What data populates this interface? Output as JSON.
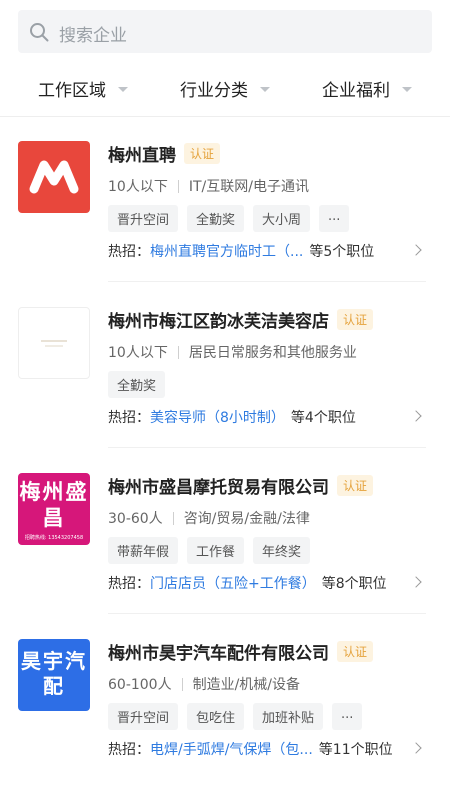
{
  "search": {
    "placeholder": "搜索企业"
  },
  "filters": [
    {
      "label": "工作区域"
    },
    {
      "label": "行业分类"
    },
    {
      "label": "企业福利"
    }
  ],
  "colors": {
    "link": "#2f7be0",
    "badge_bg": "#fdf3e0",
    "badge_text": "#e5a23b"
  },
  "companies": [
    {
      "name": "梅州直聘",
      "badge": "认证",
      "size": "10人以下",
      "industry": "IT/互联网/电子通讯",
      "tags": [
        "晋升空间",
        "全勤奖",
        "大小周",
        "..."
      ],
      "hot_prefix": "热招：",
      "hot_job": "梅州直聘官方临时工（...",
      "hot_count": "等5个职位",
      "logo_icon": "mz-logo"
    },
    {
      "name": "梅州市梅江区韵冰芙洁美容店",
      "badge": "认证",
      "size": "10人以下",
      "industry": "居民日常服务和其他服务业",
      "tags": [
        "全勤奖"
      ],
      "hot_prefix": "热招：",
      "hot_job": "美容导师（8小时制）",
      "hot_count": "等4个职位",
      "logo_icon": "beauty-logo"
    },
    {
      "name": "梅州市盛昌摩托贸易有限公司",
      "badge": "认证",
      "size": "30-60人",
      "industry": "咨询/贸易/金融/法律",
      "tags": [
        "带薪年假",
        "工作餐",
        "年终奖"
      ],
      "hot_prefix": "热招：",
      "hot_job": "门店店员（五险+工作餐）",
      "hot_count": "等8个职位",
      "logo_icon": "shengchang-logo",
      "logo_text": "梅州盛昌",
      "logo_small": "招聘热线: 13543207458"
    },
    {
      "name": "梅州市昊宇汽车配件有限公司",
      "badge": "认证",
      "size": "60-100人",
      "industry": "制造业/机械/设备",
      "tags": [
        "晋升空间",
        "包吃住",
        "加班补贴",
        "..."
      ],
      "hot_prefix": "热招：",
      "hot_job": "电焊/手弧焊/气保焊（包...",
      "hot_count": "等11个职位",
      "logo_icon": "haoyu-logo",
      "logo_text": "昊宇汽配"
    }
  ]
}
